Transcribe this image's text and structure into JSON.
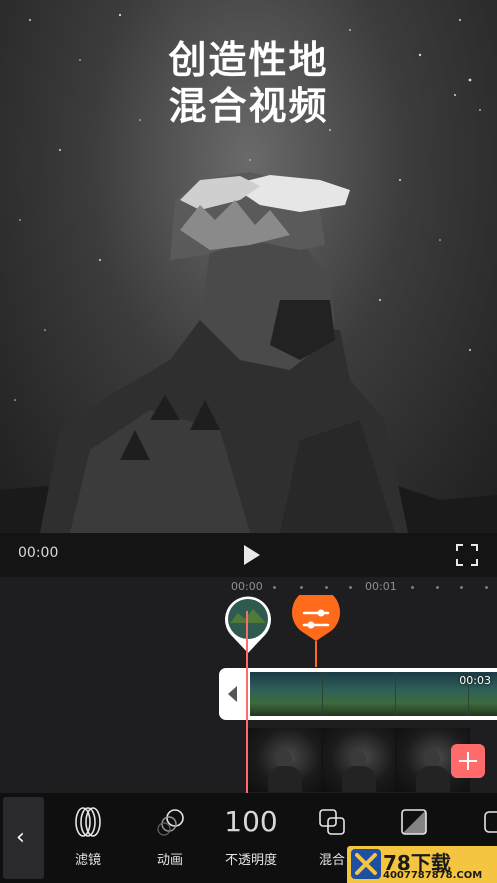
{
  "promo": {
    "headline_line1": "创造性地",
    "headline_line2": "混合视频"
  },
  "player": {
    "current_time": "00:00"
  },
  "timeline": {
    "ruler_start": "00:00",
    "ruler_mid": "00:01",
    "clip_duration": "00:03"
  },
  "toolbar": {
    "back_label": "‹",
    "items": [
      {
        "label": "滤镜",
        "icon": "filter-icon"
      },
      {
        "label": "动画",
        "icon": "animation-icon"
      },
      {
        "value": "100",
        "label": "不透明度"
      },
      {
        "label": "混合",
        "icon": "blend-icon"
      },
      {
        "label": "",
        "icon": "mask-icon"
      }
    ]
  },
  "watermark": {
    "brand": "78下载",
    "url": "4007787878.COM"
  },
  "colors": {
    "accent": "#ff6b6b",
    "adjust_pin": "#ff6b1a",
    "watermark": "#f5c542"
  }
}
